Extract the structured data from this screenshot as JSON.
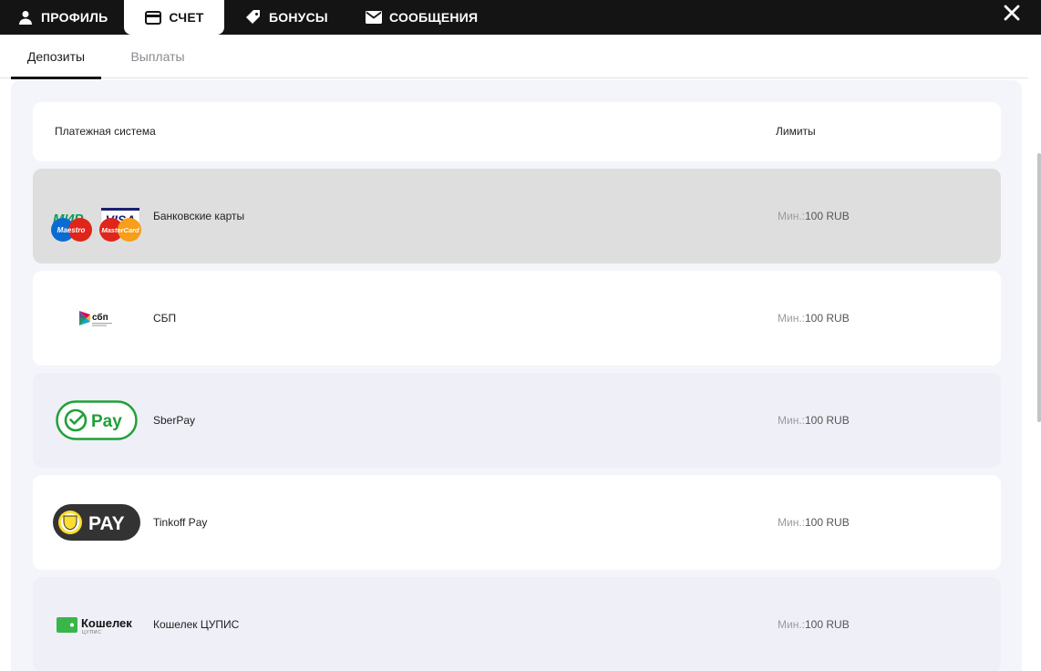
{
  "nav": {
    "tabs": [
      {
        "label": "ПРОФИЛЬ",
        "icon": "user-icon"
      },
      {
        "label": "СЧЕТ",
        "icon": "wallet-icon",
        "active": true
      },
      {
        "label": "БОНУСЫ",
        "icon": "tag-icon"
      },
      {
        "label": "СООБЩЕНИЯ",
        "icon": "envelope-icon"
      }
    ],
    "close_icon": "close-icon"
  },
  "subtabs": [
    {
      "label": "Депозиты",
      "active": true
    },
    {
      "label": "Выплаты"
    }
  ],
  "table": {
    "col_system": "Платежная система",
    "col_limits": "Лимиты",
    "rows": [
      {
        "name": "Банковские карты",
        "min_label": "Мин.:",
        "min_value": "100 RUB",
        "logo": "bank-cards-logo",
        "logo_text": {
          "mir": "МИР",
          "visa": "VISA",
          "maestro": "Maestro",
          "mastercard": "MasterCard"
        }
      },
      {
        "name": "СБП",
        "min_label": "Мин.:",
        "min_value": "100 RUB",
        "logo": "sbp-logo",
        "logo_text": "сбп"
      },
      {
        "name": "SberPay",
        "min_label": "Мин.:",
        "min_value": "100 RUB",
        "logo": "sberpay-logo",
        "logo_text": "Pay"
      },
      {
        "name": "Tinkoff Pay",
        "min_label": "Мин.:",
        "min_value": "100 RUB",
        "logo": "tinkoff-pay-logo",
        "logo_text": "PAY"
      },
      {
        "name": "Кошелек ЦУПИС",
        "min_label": "Мин.:",
        "min_value": "100 RUB",
        "logo": "cupis-wallet-logo",
        "logo_text": {
          "title": "Кошелек",
          "sub": "ЦУПИС"
        }
      }
    ]
  },
  "colors": {
    "nav_bg": "#141414",
    "panel_bg": "#f4f5fa",
    "row_alt": "#efeff8",
    "row_hover": "#dedede",
    "sber_green": "#21a038"
  }
}
